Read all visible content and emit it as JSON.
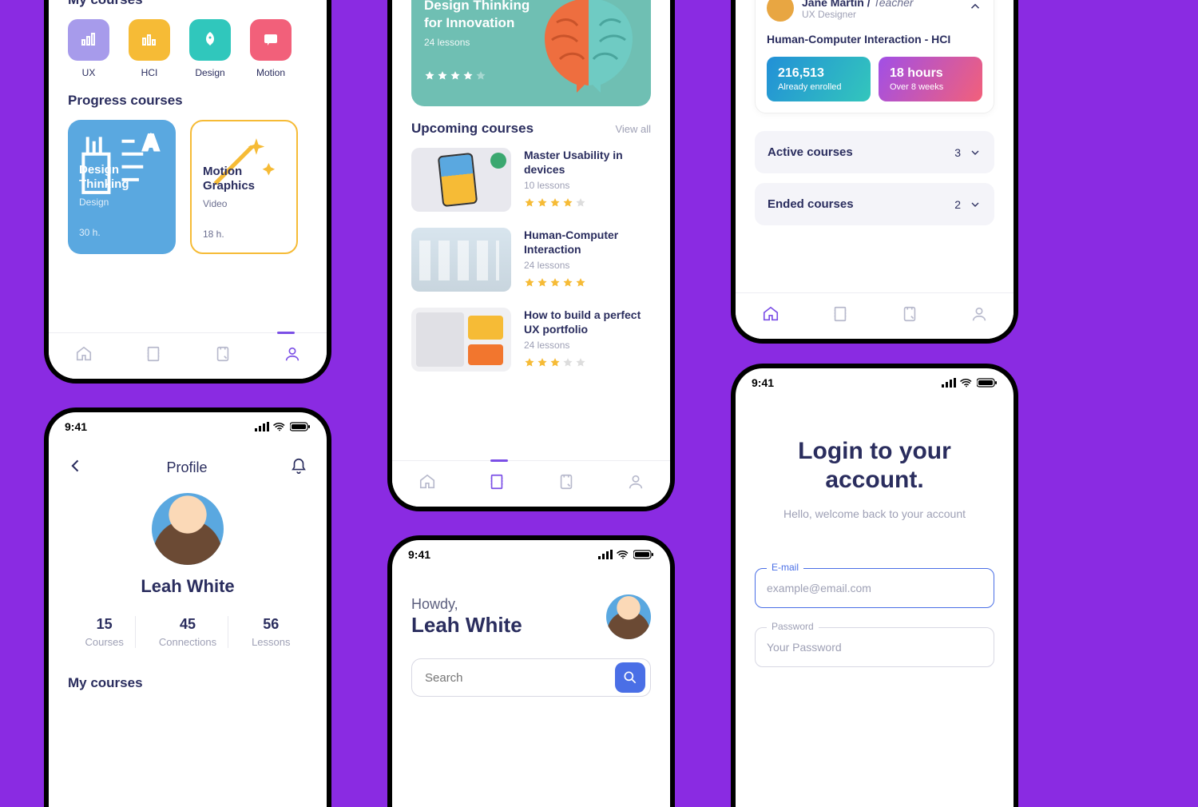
{
  "status_time": "9:41",
  "screen1": {
    "my_courses_title": "My courses",
    "categories": [
      {
        "label": "UX"
      },
      {
        "label": "HCI"
      },
      {
        "label": "Design"
      },
      {
        "label": "Motion"
      }
    ],
    "progress_title": "Progress courses",
    "progress": [
      {
        "title": "Design Thinking",
        "sub": "Design",
        "hours": "30 h."
      },
      {
        "title": "Motion Graphics",
        "sub": "Video",
        "hours": "18 h."
      }
    ]
  },
  "screen2": {
    "title": "Profile",
    "name": "Leah White",
    "stats": [
      {
        "n": "15",
        "l": "Courses"
      },
      {
        "n": "45",
        "l": "Connections"
      },
      {
        "n": "56",
        "l": "Lessons"
      }
    ],
    "my_courses_title": "My courses"
  },
  "screen3": {
    "featured": {
      "title": "Design Thinking for Innovation",
      "lessons": "24 lessons"
    },
    "upcoming_title": "Upcoming courses",
    "view_all": "View all",
    "items": [
      {
        "title": "Master Usability in devices",
        "lessons": "10 lessons"
      },
      {
        "title": "Human-Computer Interaction",
        "lessons": "24 lessons"
      },
      {
        "title": "How to build a perfect UX portfolio",
        "lessons": "24 lessons"
      }
    ]
  },
  "screen4": {
    "greet": "Howdy,",
    "name": "Leah White",
    "search_placeholder": "Search"
  },
  "screen5": {
    "teacher_name": "Jane Martin",
    "teacher_slash": " / ",
    "teacher_role": "Teacher",
    "teacher_job": "UX Designer",
    "teacher_course": "Human-Computer Interaction - HCI",
    "chip_enrolled_n": "216,513",
    "chip_enrolled_l": "Already enrolled",
    "chip_hours_n": "18 hours",
    "chip_hours_l": "Over 8 weeks",
    "active_label": "Active courses",
    "active_count": "3",
    "ended_label": "Ended courses",
    "ended_count": "2"
  },
  "screen6": {
    "title": "Login to your account.",
    "sub": "Hello, welcome back to your account",
    "email_label": "E-mail",
    "email_placeholder": "example@email.com",
    "password_label": "Password",
    "password_placeholder": "Your Password"
  }
}
